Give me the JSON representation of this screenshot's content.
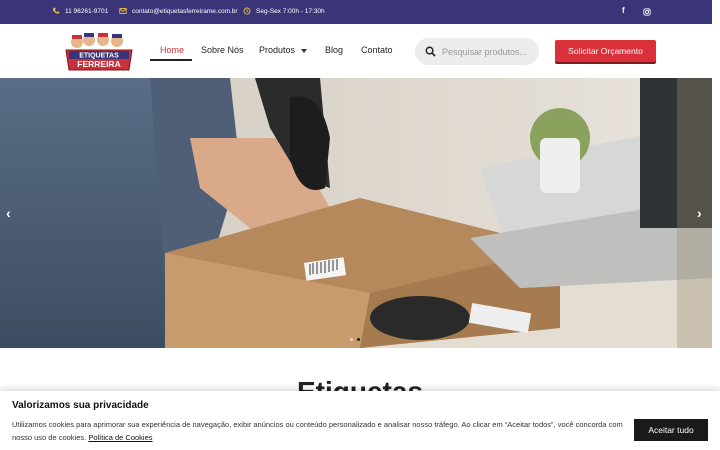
{
  "topbar": {
    "phone": "11 96261-9701",
    "email": "contato@etiquetasferreirame.com.br",
    "hours": "Seg-Sex 7:00h - 17:30h",
    "facebook_glyph": "f",
    "instagram_icon": "instagram-icon",
    "background": "#3a3578"
  },
  "logo": {
    "line1": "ETIQUETAS",
    "line2": "FERREIRA"
  },
  "nav": {
    "home": "Home",
    "about": "Sobre Nós",
    "products": "Produtos",
    "blog": "Blog",
    "contact": "Contato"
  },
  "search": {
    "placeholder": "Pesquisar produtos..."
  },
  "cta": {
    "label": "Solicitar Orçamento",
    "color": "#d9303a"
  },
  "slider": {
    "prev": "‹",
    "next": "›",
    "slide_count": 2,
    "active_slide": 2
  },
  "section": {
    "title": "Etiquetas"
  },
  "cookie": {
    "title": "Valorizamos sua privacidade",
    "text": "Utilizamos cookies para aprimorar sua experiência de navegação, exibir anúncios ou conteúdo personalizado e analisar nosso tráfego. Ao clicar em “Aceitar todos”, você concorda com nosso uso de cookies.",
    "policy_link": "Política de Cookies",
    "accept": "Aceitar tudo"
  }
}
